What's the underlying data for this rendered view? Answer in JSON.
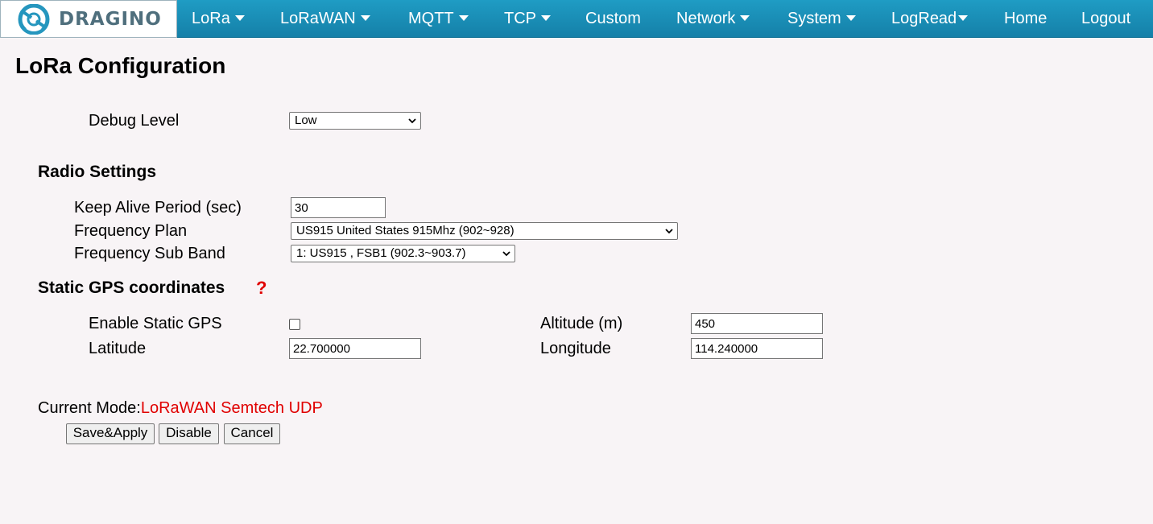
{
  "brand": {
    "logo_text": "DRAGINO"
  },
  "nav": {
    "lora": "LoRa",
    "lorawan": "LoRaWAN",
    "mqtt": "MQTT",
    "tcp": "TCP",
    "custom": "Custom",
    "network": "Network",
    "system": "System",
    "logread": "LogRead",
    "home": "Home",
    "logout": "Logout"
  },
  "page": {
    "title": "LoRa Configuration"
  },
  "debug": {
    "label": "Debug Level",
    "value": "Low"
  },
  "radio": {
    "title": "Radio Settings",
    "keep_alive_label": "Keep Alive Period (sec)",
    "keep_alive_value": "30",
    "freq_plan_label": "Frequency Plan",
    "freq_plan_value": "US915 United States 915Mhz (902~928)",
    "sub_band_label": "Frequency Sub Band",
    "sub_band_value": "1: US915 , FSB1 (902.3~903.7)"
  },
  "gps": {
    "title": "Static GPS coordinates",
    "help": "?",
    "enable_label": "Enable Static GPS",
    "enable_checked": false,
    "altitude_label": "Altitude (m)",
    "altitude_value": "450",
    "latitude_label": "Latitude",
    "latitude_value": "22.700000",
    "longitude_label": "Longitude",
    "longitude_value": "114.240000"
  },
  "mode": {
    "label": "Current Mode:",
    "value": "LoRaWAN Semtech UDP"
  },
  "buttons": {
    "save": "Save&Apply",
    "disable": "Disable",
    "cancel": "Cancel"
  },
  "colors": {
    "nav_bg": "#1a8fb8",
    "accent_red": "#e00000",
    "page_bg": "#f8f4f6"
  }
}
